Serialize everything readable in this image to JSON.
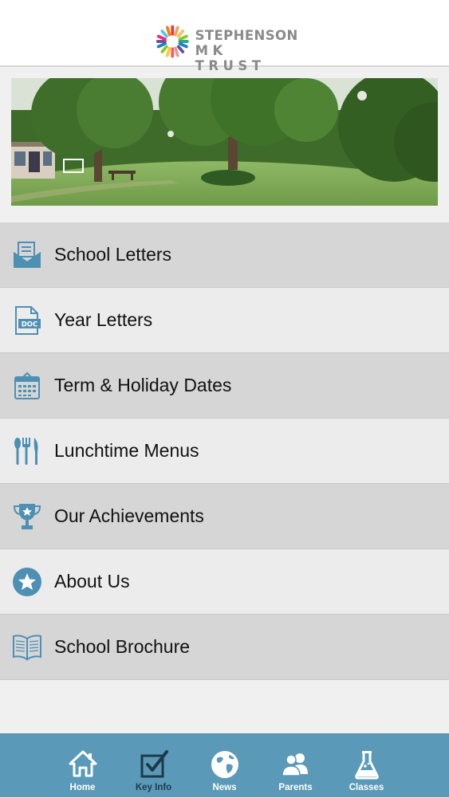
{
  "header": {
    "logo_line1": "STEPHENSON",
    "logo_line2": "MK TRUST",
    "logo_icon": "starburst-logo"
  },
  "menu": {
    "items": [
      {
        "label": "School Letters",
        "icon": "envelope-icon"
      },
      {
        "label": "Year Letters",
        "icon": "doc-file-icon"
      },
      {
        "label": "Term & Holiday Dates",
        "icon": "calendar-icon"
      },
      {
        "label": "Lunchtime Menus",
        "icon": "cutlery-icon"
      },
      {
        "label": "Our Achievements",
        "icon": "trophy-icon"
      },
      {
        "label": "About Us",
        "icon": "star-badge-icon"
      },
      {
        "label": "School Brochure",
        "icon": "open-book-icon"
      }
    ]
  },
  "tabbar": {
    "tabs": [
      {
        "label": "Home",
        "icon": "home-icon"
      },
      {
        "label": "Key Info",
        "icon": "checkbox-icon"
      },
      {
        "label": "News",
        "icon": "globe-icon"
      },
      {
        "label": "Parents",
        "icon": "people-icon"
      },
      {
        "label": "Classes",
        "icon": "flask-icon"
      }
    ]
  },
  "colors": {
    "icon_blue": "#4d90b3",
    "tabbar_bg": "#5a9ab8",
    "menu_odd": "#d6d6d6",
    "menu_even": "#ececec",
    "logo_text": "#8a8a8a"
  }
}
